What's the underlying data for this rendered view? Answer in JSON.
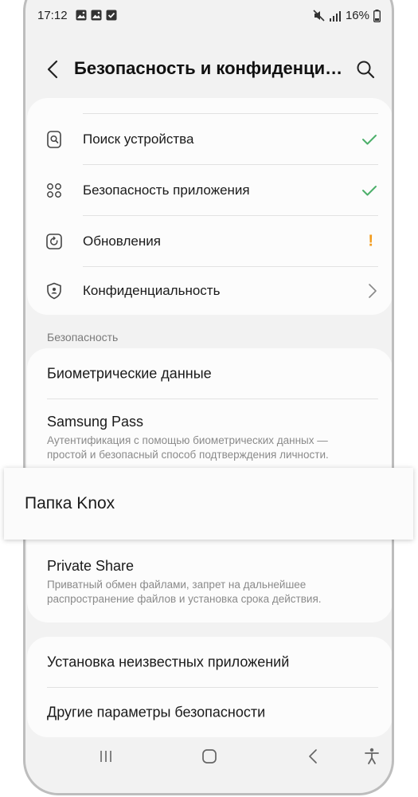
{
  "status": {
    "time": "17:12",
    "battery": "16%"
  },
  "header": {
    "title": "Безопасность и конфиденциальность"
  },
  "top_list": [
    {
      "label": "Поиск устройства"
    },
    {
      "label": "Безопасность приложения"
    },
    {
      "label": "Обновления",
      "indicator": "!"
    },
    {
      "label": "Конфиденциальность"
    }
  ],
  "section": {
    "title": "Безопасность"
  },
  "security_list": {
    "biometrics": {
      "title": "Биометрические данные"
    },
    "samsung_pass": {
      "title": "Samsung Pass",
      "subtitle_line1": "Аутентификация с помощью биометрических данных —",
      "subtitle_line2": "простой и безопасный способ подтверждения личности."
    }
  },
  "knox": {
    "label": "Папка Knox"
  },
  "private_share": {
    "title": "Private Share",
    "subtitle_line1": "Приватный обмен файлами, запрет на дальнейшее",
    "subtitle_line2": "распространение файлов и установка срока действия."
  },
  "bottom_list": [
    {
      "label": "Установка неизвестных приложений"
    },
    {
      "label": "Другие параметры безопасности"
    }
  ],
  "colors": {
    "check": "#4caf6a",
    "warning": "#f39c1e",
    "background": "#f2f2f2"
  }
}
